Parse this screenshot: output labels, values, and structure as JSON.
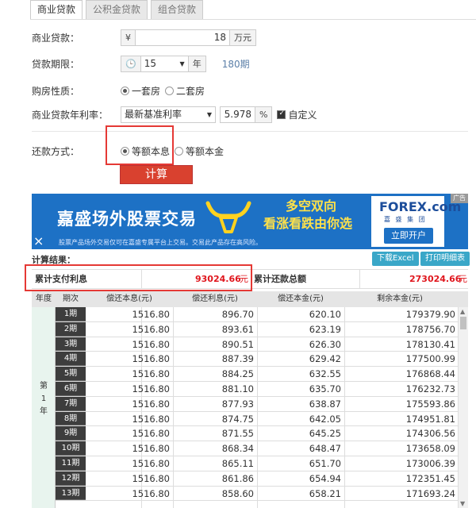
{
  "tabs": [
    "商业贷款",
    "公积金贷款",
    "组合贷款"
  ],
  "form": {
    "loan_amount_label": "商业贷款：",
    "currency_symbol": "¥",
    "loan_amount_value": "18",
    "loan_amount_unit": "万元",
    "term_label": "贷款期限：",
    "term_value": "15",
    "term_unit": "年",
    "term_periods": "180期",
    "property_label": "购房性质：",
    "property_options": [
      "一套房",
      "二套房"
    ],
    "rate_label": "商业贷款年利率：",
    "rate_select": "最新基准利率",
    "rate_value": "5.978",
    "rate_unit": "%",
    "custom_label": "自定义",
    "repay_label": "还款方式：",
    "repay_options": [
      "等额本息",
      "等额本金"
    ],
    "calc_button": "计算"
  },
  "ad": {
    "title": "嘉盛场外股票交易",
    "tag1": "多空双向",
    "tag2": "看涨看跌由你选",
    "logo": "FOREX.com",
    "logo_sub": "嘉 盛 集 团",
    "cta": "立即开户",
    "footnote": "股票产品场外交易仅可在嘉盛专属平台上交易。交易此产品存在高风险。",
    "corner": "广告",
    "close_icon": "×"
  },
  "results": {
    "title": "计算结果：",
    "download_btn": "下载Excel",
    "print_btn": "打印明细表",
    "total_interest_label": "累计支付利息",
    "total_interest_value": "93024.66",
    "total_repay_label": "累计还款总额",
    "total_repay_value": "273024.66",
    "unit": "元"
  },
  "table": {
    "headers": [
      "年度",
      "期次",
      "偿还本息(元)",
      "偿还利息(元)",
      "偿还本金(元)",
      "剩余本金(元)"
    ],
    "year_label": "第\n1\n年",
    "rows": [
      [
        "1期",
        "1516.80",
        "896.70",
        "620.10",
        "179379.90"
      ],
      [
        "2期",
        "1516.80",
        "893.61",
        "623.19",
        "178756.70"
      ],
      [
        "3期",
        "1516.80",
        "890.51",
        "626.30",
        "178130.41"
      ],
      [
        "4期",
        "1516.80",
        "887.39",
        "629.42",
        "177500.99"
      ],
      [
        "5期",
        "1516.80",
        "884.25",
        "632.55",
        "176868.44"
      ],
      [
        "6期",
        "1516.80",
        "881.10",
        "635.70",
        "176232.73"
      ],
      [
        "7期",
        "1516.80",
        "877.93",
        "638.87",
        "175593.86"
      ],
      [
        "8期",
        "1516.80",
        "874.75",
        "642.05",
        "174951.81"
      ],
      [
        "9期",
        "1516.80",
        "871.55",
        "645.25",
        "174306.56"
      ],
      [
        "10期",
        "1516.80",
        "868.34",
        "648.47",
        "173658.09"
      ],
      [
        "11期",
        "1516.80",
        "865.11",
        "651.70",
        "173006.39"
      ],
      [
        "12期",
        "1516.80",
        "861.86",
        "654.94",
        "172351.45"
      ],
      [
        "13期",
        "1516.80",
        "858.60",
        "658.21",
        "171693.24"
      ]
    ]
  }
}
